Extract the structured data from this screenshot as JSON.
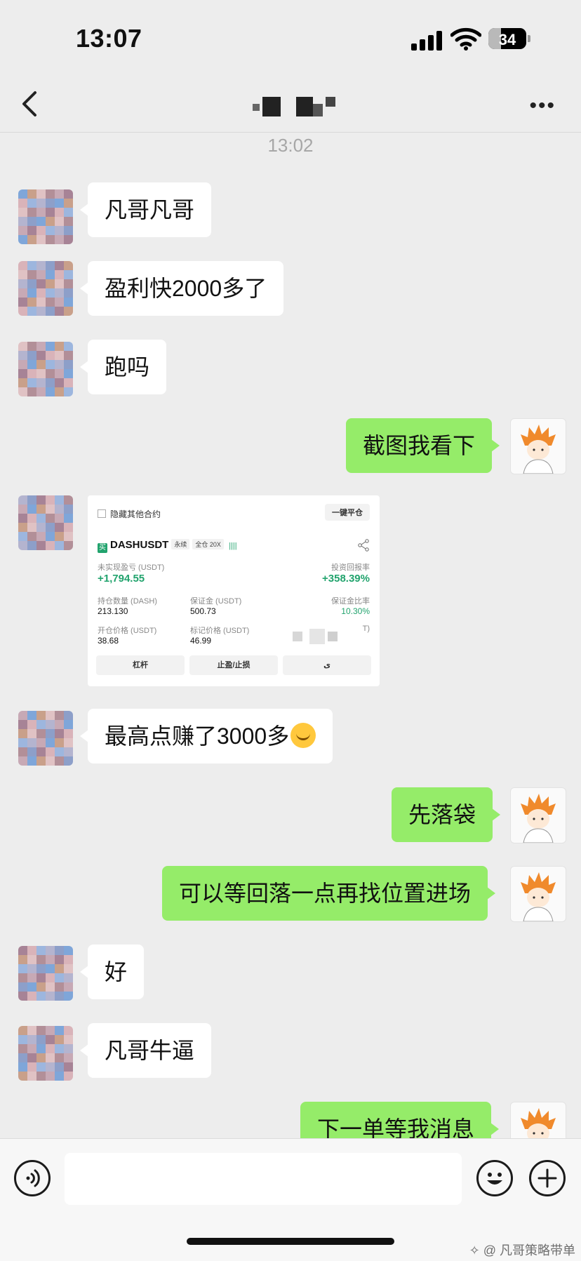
{
  "status_bar": {
    "time": "13:07",
    "battery": "34",
    "battery_level": 0.34
  },
  "nav": {
    "title": "",
    "back_icon": "chevron-left-icon",
    "more_label": "•••"
  },
  "chat": {
    "timestamp": "13:02",
    "messages": [
      {
        "side": "left",
        "text": "凡哥凡哥"
      },
      {
        "side": "left",
        "text": "盈利快2000多了"
      },
      {
        "side": "left",
        "text": "跑吗"
      },
      {
        "side": "right",
        "text": "截图我看下"
      },
      {
        "side": "left",
        "type": "image"
      },
      {
        "side": "left",
        "text": "最高点赚了3000多",
        "emoji": "crying-laughing-emoji"
      },
      {
        "side": "right",
        "text": "先落袋"
      },
      {
        "side": "right",
        "text": "可以等回落一点再找位置进场"
      },
      {
        "side": "left",
        "text": "好"
      },
      {
        "side": "left",
        "text": "凡哥牛逼"
      },
      {
        "side": "right",
        "text": "下一单等我消息"
      }
    ]
  },
  "trade_card": {
    "hide_other": "隐藏其他合约",
    "close_all": "一键平仓",
    "symbol_icon": "买",
    "symbol": "DASHUSDT",
    "tag_perp": "永续",
    "tag_mode": "全仓 20X",
    "signal_mark": "||||",
    "pnl_label": "未实现盈亏 (USDT)",
    "pnl_value": "+1,794.55",
    "roi_label": "投资回报率",
    "roi_value": "+358.39%",
    "qty_label": "持仓数量 (DASH)",
    "qty_value": "213.130",
    "margin_label": "保证金 (USDT)",
    "margin_value": "500.73",
    "margin_ratio_label": "保证金比率",
    "margin_ratio_value": "10.30%",
    "open_label": "开仓价格 (USDT)",
    "open_value": "38.68",
    "mark_label": "标记价格 (USDT)",
    "mark_value": "46.99",
    "liq_label_fragment": "T)",
    "btn_leverage": "杠杆",
    "btn_tpsl": "止盈/止损",
    "btn_third": "ی"
  },
  "input_bar": {
    "placeholder": ""
  },
  "watermark": "凡哥策略带单"
}
